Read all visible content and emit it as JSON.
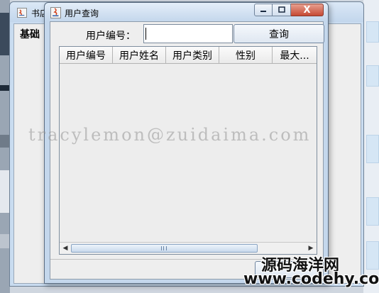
{
  "back_window": {
    "title": "书店",
    "menu_label": "基础"
  },
  "dialog": {
    "title": "用户查询",
    "window_buttons": {
      "minimize": "▭",
      "maximize": "□",
      "close": "X"
    },
    "search": {
      "label": "用户编号：",
      "input_value": "",
      "button_label": "查询"
    },
    "table": {
      "columns": [
        "用户编号",
        "用户姓名",
        "用户类别",
        "性别",
        "最大..."
      ],
      "rows": []
    },
    "scrollbar": {
      "left_arrow": "◀",
      "right_arrow": "▶"
    }
  },
  "overlays": {
    "watermark": "tracylemon@zuidaima.com",
    "site_name": "源码海洋网",
    "site_url": "www.codehy.com"
  },
  "colors": {
    "title_bar": "#c4d7ec",
    "close_button": "#c64a34",
    "content_bg": "#eeeeee"
  }
}
